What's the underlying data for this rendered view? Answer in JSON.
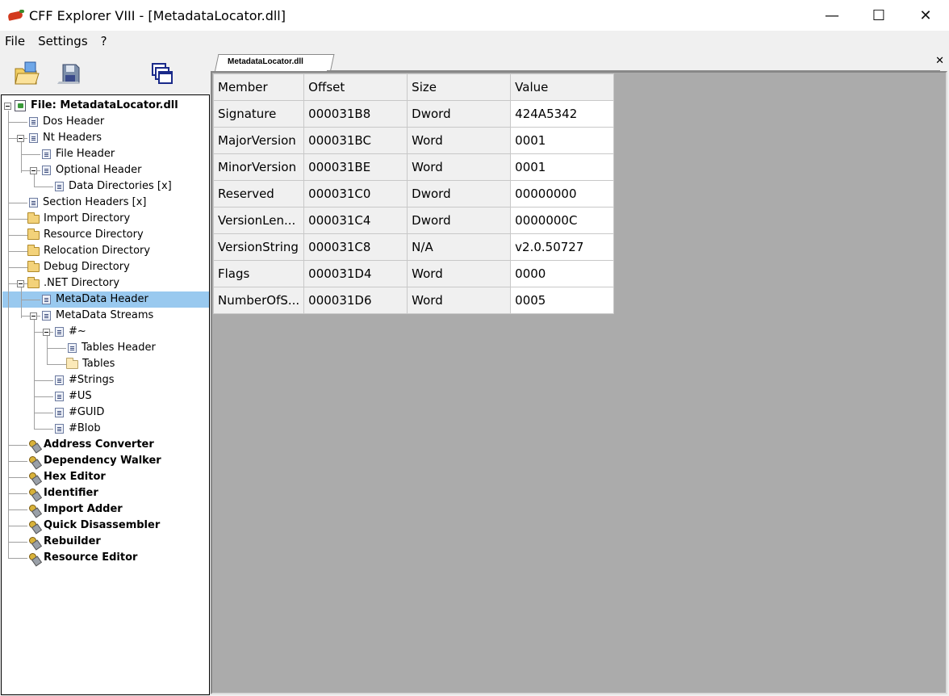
{
  "window": {
    "title": "CFF Explorer VIII - [MetadataLocator.dll]",
    "controls": {
      "minimize": "—",
      "maximize": "☐",
      "close": "✕"
    }
  },
  "menu": {
    "items": [
      {
        "label": "File"
      },
      {
        "label": "Settings"
      },
      {
        "label": "?"
      }
    ]
  },
  "toolbar": {
    "buttons": [
      {
        "icon": "open-folder-icon"
      },
      {
        "icon": "save-disk-icon"
      },
      {
        "icon": "windows-cascade-icon"
      }
    ]
  },
  "tab": {
    "label": "MetadataLocator.dll",
    "close": "✕"
  },
  "tree": {
    "root": "File: MetadataLocator.dll",
    "items": [
      {
        "label": "Dos Header",
        "icon": "doc"
      },
      {
        "label": "Nt Headers",
        "icon": "doc"
      },
      {
        "label": "File Header",
        "icon": "doc"
      },
      {
        "label": "Optional Header",
        "icon": "doc"
      },
      {
        "label": "Data Directories [x]",
        "icon": "doc"
      },
      {
        "label": "Section Headers [x]",
        "icon": "doc"
      },
      {
        "label": "Import Directory",
        "icon": "folder"
      },
      {
        "label": "Resource Directory",
        "icon": "folder"
      },
      {
        "label": "Relocation Directory",
        "icon": "folder"
      },
      {
        "label": "Debug Directory",
        "icon": "folder"
      },
      {
        "label": ".NET Directory",
        "icon": "folder"
      },
      {
        "label": "MetaData Header",
        "icon": "doc"
      },
      {
        "label": "MetaData Streams",
        "icon": "doc"
      },
      {
        "label": "#~",
        "icon": "doc"
      },
      {
        "label": "Tables Header",
        "icon": "doc"
      },
      {
        "label": "Tables",
        "icon": "folder-open"
      },
      {
        "label": "#Strings",
        "icon": "doc"
      },
      {
        "label": "#US",
        "icon": "doc"
      },
      {
        "label": "#GUID",
        "icon": "doc"
      },
      {
        "label": "#Blob",
        "icon": "doc"
      },
      {
        "label": "Address Converter",
        "icon": "tool"
      },
      {
        "label": "Dependency Walker",
        "icon": "tool"
      },
      {
        "label": "Hex Editor",
        "icon": "tool"
      },
      {
        "label": "Identifier",
        "icon": "tool"
      },
      {
        "label": "Import Adder",
        "icon": "tool"
      },
      {
        "label": "Quick Disassembler",
        "icon": "tool"
      },
      {
        "label": "Rebuilder",
        "icon": "tool"
      },
      {
        "label": "Resource Editor",
        "icon": "tool"
      }
    ],
    "selected": "MetaData Header"
  },
  "grid": {
    "columns": [
      "Member",
      "Offset",
      "Size",
      "Value"
    ],
    "rows": [
      [
        "Signature",
        "000031B8",
        "Dword",
        "424A5342"
      ],
      [
        "MajorVersion",
        "000031BC",
        "Word",
        "0001"
      ],
      [
        "MinorVersion",
        "000031BE",
        "Word",
        "0001"
      ],
      [
        "Reserved",
        "000031C0",
        "Dword",
        "00000000"
      ],
      [
        "VersionLen...",
        "000031C4",
        "Dword",
        "0000000C"
      ],
      [
        "VersionString",
        "000031C8",
        "N/A",
        "v2.0.50727"
      ],
      [
        "Flags",
        "000031D4",
        "Word",
        "0000"
      ],
      [
        "NumberOfS...",
        "000031D6",
        "Word",
        "0005"
      ]
    ]
  },
  "colors": {
    "selection": "#99c9ef",
    "content_background": "#ababab"
  }
}
